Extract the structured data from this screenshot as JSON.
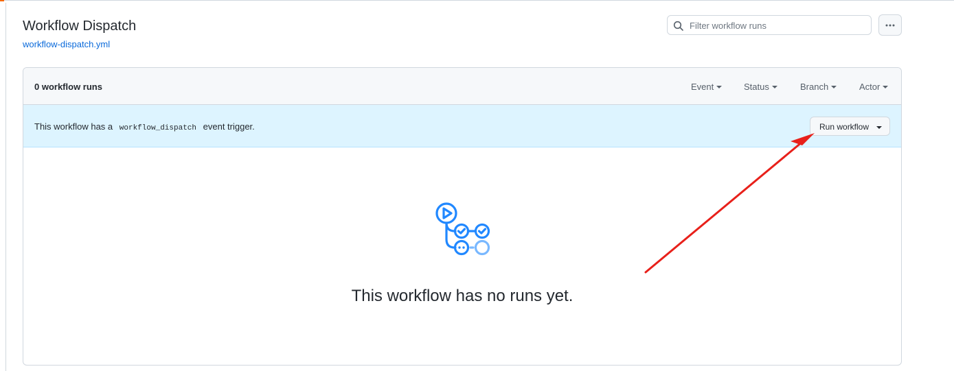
{
  "header": {
    "title": "Workflow Dispatch",
    "workflow_file": "workflow-dispatch.yml"
  },
  "search": {
    "placeholder": "Filter workflow runs",
    "value": ""
  },
  "runs": {
    "count_label": "0 workflow runs",
    "filters": [
      "Event",
      "Status",
      "Branch",
      "Actor"
    ]
  },
  "banner": {
    "text_before": "This workflow has a",
    "code": "workflow_dispatch",
    "text_after": "event trigger.",
    "button_label": "Run workflow"
  },
  "empty_state": {
    "message": "This workflow has no runs yet.",
    "icon": "workflow-icon"
  },
  "colors": {
    "accent_blue": "#0969da",
    "icon_blue": "#2188ff",
    "banner_bg": "#ddf4ff",
    "annotation_arrow": "#e8201a"
  }
}
